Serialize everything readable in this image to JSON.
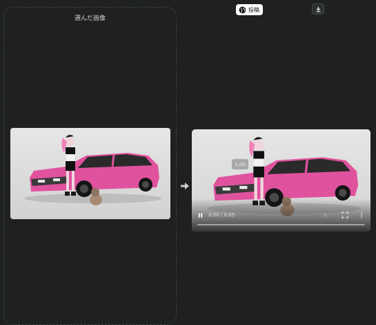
{
  "left_panel": {
    "title": "選んだ画像"
  },
  "toolbar": {
    "post_label": "投稿"
  },
  "video": {
    "speed_label": "1.00",
    "time_label": "0:00 / 0:05",
    "progress": 0
  },
  "icons": {
    "post": "globe-icon",
    "download": "download-icon",
    "transition": "arrow-right-icon",
    "play": "pause-icon",
    "volume": "volume-icon",
    "fullscreen": "fullscreen-icon",
    "more": "more-vert-icon"
  },
  "colors": {
    "background": "#1f2121",
    "car": "#e0529e",
    "accent_button": "#ffffff"
  }
}
